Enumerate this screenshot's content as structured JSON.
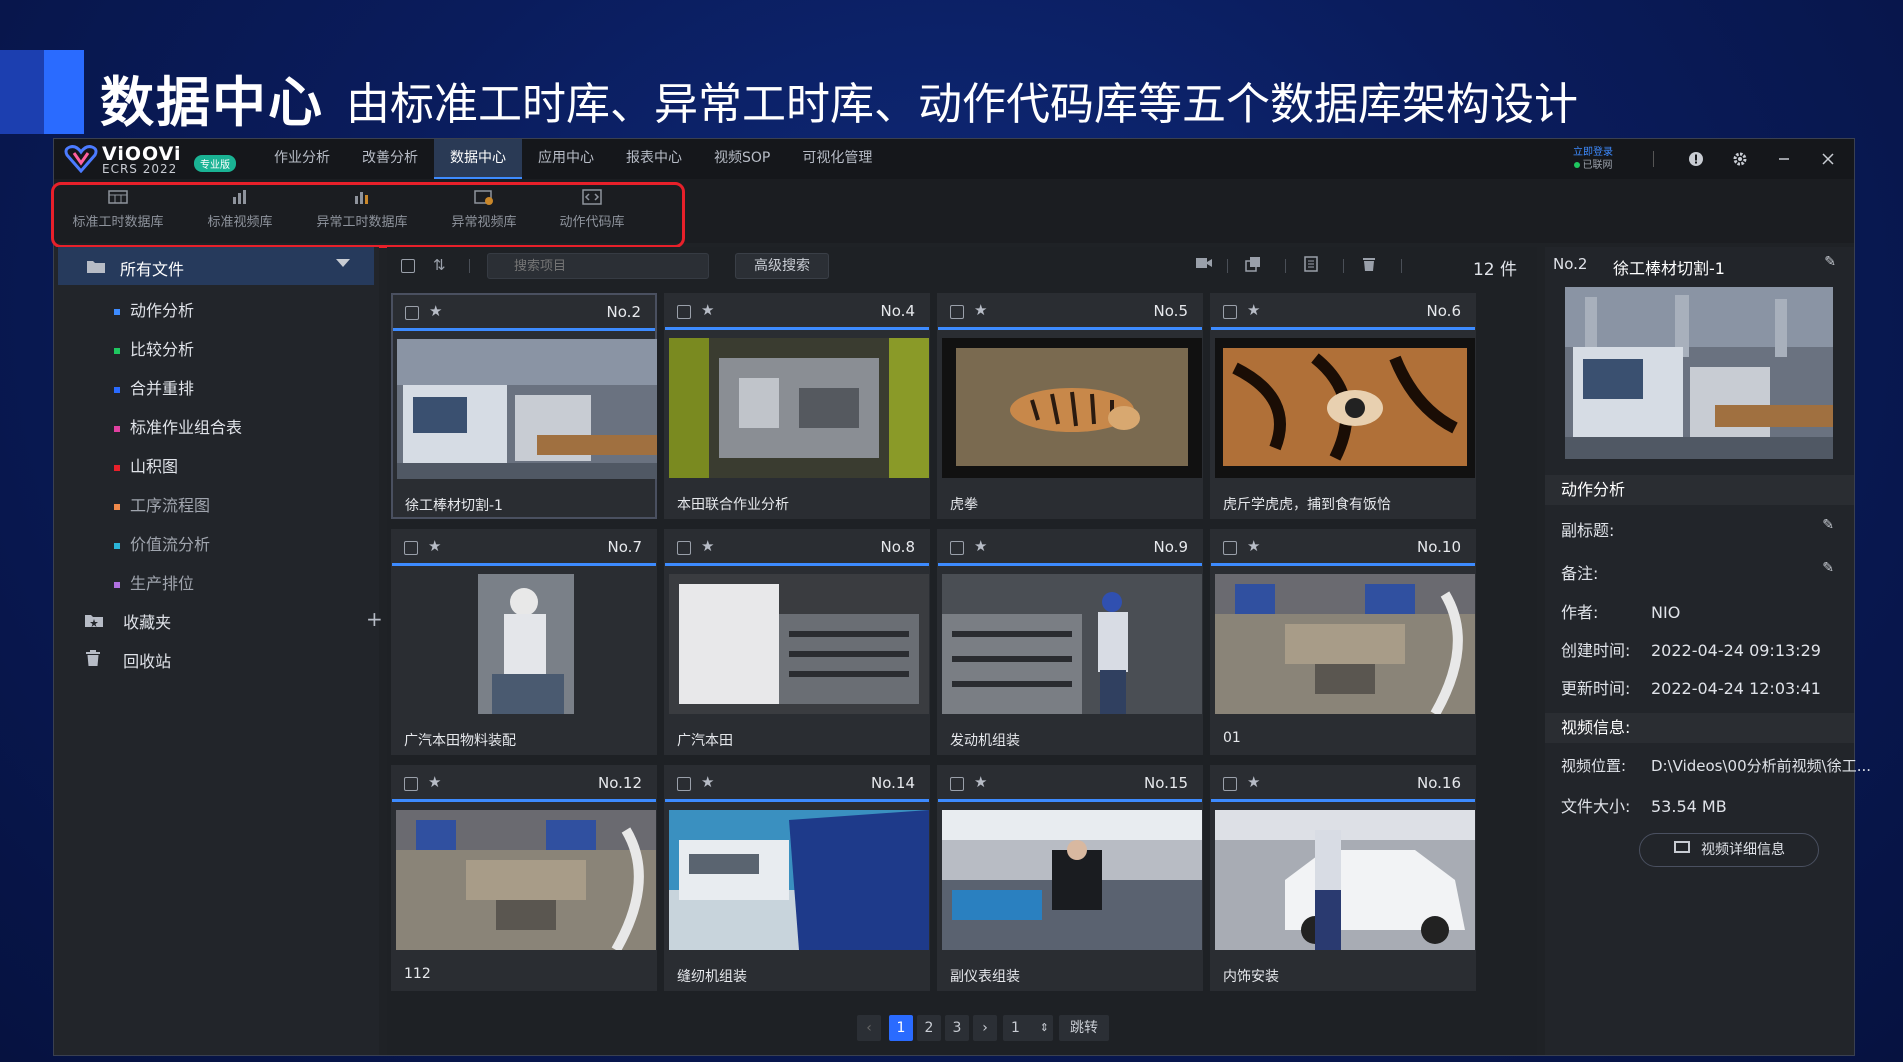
{
  "slide": {
    "title": "数据中心",
    "subtitle": "由标准工时库、异常工时库、动作代码库等五个数据库架构设计"
  },
  "app": {
    "logo": {
      "name": "ViOOVi",
      "version": "ECRS 2022",
      "badge": "专业版"
    },
    "nav": [
      "作业分析",
      "改善分析",
      "数据中心",
      "应用中心",
      "报表中心",
      "视频SOP",
      "可视化管理"
    ],
    "nav_active": "数据中心",
    "login": {
      "link": "立即登录",
      "status": "已联网"
    },
    "accent": "#2a6bff",
    "highlight_color": "#e8202a"
  },
  "databases": [
    {
      "label": "标准工时数据库",
      "icon": "table-icon"
    },
    {
      "label": "标准视频库",
      "icon": "bar-chart-icon"
    },
    {
      "label": "异常工时数据库",
      "icon": "hand-chart-icon"
    },
    {
      "label": "异常视频库",
      "icon": "video-warning-icon"
    },
    {
      "label": "动作代码库",
      "icon": "code-icon"
    }
  ],
  "sidebar": {
    "root": "所有文件",
    "items": [
      {
        "label": "动作分析",
        "color": "#3d8bff"
      },
      {
        "label": "比较分析",
        "color": "#1fc760"
      },
      {
        "label": "合并重排",
        "color": "#2a6bff"
      },
      {
        "label": "标准作业组合表",
        "color": "#e040a0"
      },
      {
        "label": "山积图",
        "color": "#e8202a"
      },
      {
        "label": "工序流程图",
        "color": "#f08a4b"
      },
      {
        "label": "价值流分析",
        "color": "#2bb5d8"
      },
      {
        "label": "生产排位",
        "color": "#b070e0"
      }
    ],
    "favorites": "收藏夹",
    "trash": "回收站"
  },
  "content": {
    "search_placeholder": "搜索项目",
    "advanced_search": "高级搜索",
    "count": "12 件",
    "cards": [
      {
        "no": "No.2",
        "title": "徐工棒材切割-1",
        "thumb": "factory"
      },
      {
        "no": "No.4",
        "title": "本田联合作业分析",
        "thumb": "machine"
      },
      {
        "no": "No.5",
        "title": "虎拳",
        "thumb": "tiger"
      },
      {
        "no": "No.6",
        "title": "虎斤学虎虎，捕到食有饭恰",
        "thumb": "tiger-close"
      },
      {
        "no": "No.7",
        "title": "广汽本田物料装配",
        "thumb": "worker-portrait"
      },
      {
        "no": "No.8",
        "title": "广汽本田",
        "thumb": "engine"
      },
      {
        "no": "No.9",
        "title": "发动机组装",
        "thumb": "engine-worker"
      },
      {
        "no": "No.10",
        "title": "01",
        "thumb": "warehouse"
      },
      {
        "no": "No.12",
        "title": "112",
        "thumb": "warehouse"
      },
      {
        "no": "No.14",
        "title": "缝纫机组装",
        "thumb": "sewing"
      },
      {
        "no": "No.15",
        "title": "副仪表组装",
        "thumb": "dashboard"
      },
      {
        "no": "No.16",
        "title": "内饰安装",
        "thumb": "car"
      }
    ],
    "pager": {
      "pages": [
        "1",
        "2",
        "3"
      ],
      "current": "1",
      "jump_value": "1",
      "jump_label": "跳转"
    }
  },
  "detail": {
    "no": "No.2",
    "title": "徐工棒材切割-1",
    "section1": "动作分析",
    "subtitle_label": "副标题:",
    "remark_label": "备注:",
    "author_label": "作者:",
    "author": "NIO",
    "created_label": "创建时间:",
    "created": "2022-04-24 09:13:29",
    "updated_label": "更新时间:",
    "updated": "2022-04-24 12:03:41",
    "section2": "视频信息:",
    "location_label": "视频位置:",
    "location": "D:\\Videos\\00分析前视频\\徐工...",
    "size_label": "文件大小:",
    "size": "53.54 MB",
    "detail_button": "视频详细信息"
  }
}
